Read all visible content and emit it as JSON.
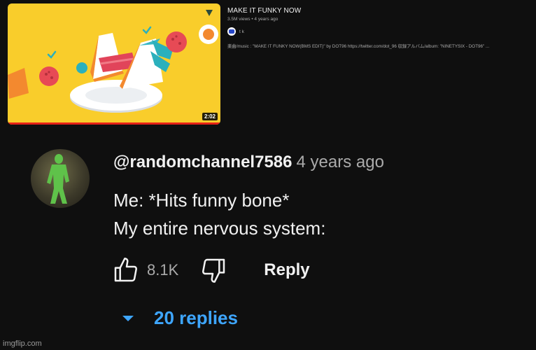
{
  "video": {
    "title": "MAKE IT FUNKY NOW",
    "meta": "3.5M views • 4 years ago",
    "channel": "t k",
    "description": "楽曲/music : \"MAKE IT FUNKY NOW(BMS EDIT)\" by DOT96 https://twitter.com/dot_96 収録アルバム/album: \"NINETYSIX - DOT96\" ...",
    "duration": "2:02",
    "progress": 1.0
  },
  "comment": {
    "author": "@randomchannel7586",
    "time": "4 years ago",
    "lines": [
      "Me: *Hits funny bone*",
      "My entire nervous system:"
    ],
    "likes": "8.1K",
    "reply_label": "Reply",
    "replies_label": "20 replies"
  },
  "watermark": "imgflip.com",
  "colors": {
    "background": "#0f0f0f",
    "thumbnail_bg": "#f9cd2b",
    "link_blue": "#3ea6ff",
    "progress_red": "#e62117"
  },
  "icons": [
    "thumbs-up-icon",
    "thumbs-down-icon",
    "caret-down-icon",
    "play-triangle-icon",
    "check-icon"
  ]
}
